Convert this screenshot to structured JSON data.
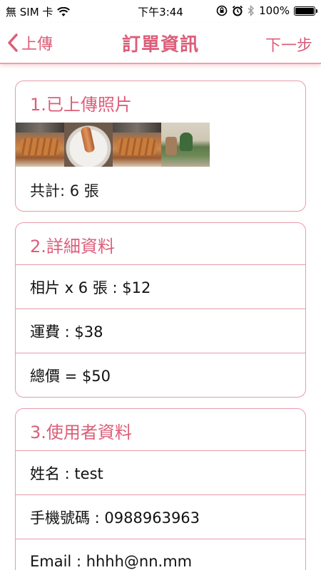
{
  "status_bar": {
    "carrier": "無 SIM 卡",
    "time": "下午3:44",
    "battery": "100%"
  },
  "nav": {
    "back_label": "上傳",
    "title": "訂單資訊",
    "next_label": "下一步"
  },
  "uploaded_photos": {
    "title": "1.已上傳照片",
    "photos": [
      "food-photo",
      "bowl-photo",
      "food-photo",
      "living-room-photo"
    ],
    "count_label": "共計: 6 張"
  },
  "details": {
    "title": "2.詳細資料",
    "rows": [
      "相片 x 6 張 : $12",
      "運費 : $38",
      "總價 = $50"
    ]
  },
  "user_info": {
    "title": "3.使用者資料",
    "rows": [
      "姓名 : test",
      "手機號碼 : 0988963963",
      "Email : hhhh@nn.mm"
    ]
  },
  "colors": {
    "accent": "#dc5e79",
    "border": "#e79aaa"
  }
}
